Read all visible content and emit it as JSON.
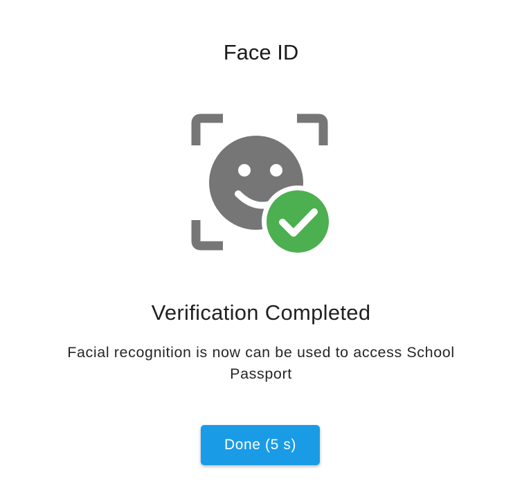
{
  "dialog": {
    "title": "Face ID",
    "illustration": {
      "icon": "face-recognition-icon",
      "badge_icon": "check-circle-icon",
      "face_color": "#767676",
      "badge_color": "#4caf50"
    },
    "heading": "Verification Completed",
    "message": "Facial recognition is now can be used to access School Passport",
    "done_button": "Done (5 s)"
  },
  "colors": {
    "primary": "#1a9be6",
    "success": "#4caf50",
    "icon_gray": "#767676"
  }
}
